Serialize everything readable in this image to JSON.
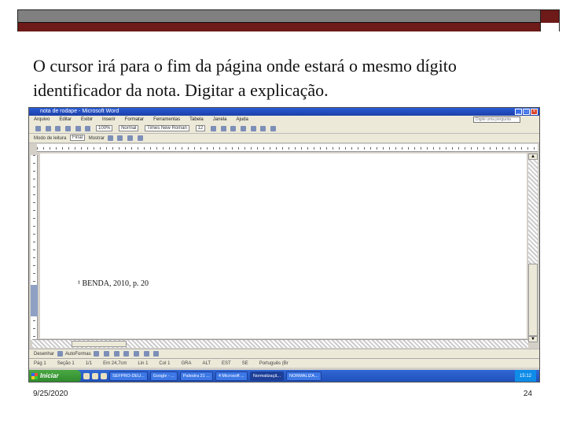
{
  "slide": {
    "text": "O cursor irá para o fim da página onde estará o mesmo dígito identificador da nota. Digitar a explicação.",
    "date": "9/25/2020",
    "page_number": "24"
  },
  "word_window": {
    "title": "nota de rodape - Microsoft Word",
    "menu": [
      "Arquivo",
      "Editar",
      "Exibir",
      "Inserir",
      "Formatar",
      "Ferramentas",
      "Tabela",
      "Janela",
      "Ajuda"
    ],
    "help_placeholder": "Digite uma pergunta",
    "toolbar1": {
      "zoom": "100%",
      "style": "Normal",
      "font": "Times New Roman",
      "font_size": "12"
    },
    "toolbar2": {
      "reading_mode": "Modo de leitura",
      "final_label": "Final",
      "show_label": "Mostrar"
    },
    "doc_text": "¹ BENDA, 2010, p. 20",
    "status_bar": [
      "Pág 1",
      "Seção 1",
      "1/1",
      "Em 24,7cm",
      "Lin 1",
      "Col 1",
      "GRA",
      "ALT",
      "EST",
      "SE",
      "Português (Br"
    ],
    "draw_bar": {
      "draw_label": "Desenhar",
      "autoshapes_label": "AutoFormas"
    }
  },
  "taskbar": {
    "start_label": "Iniciar",
    "items": [
      "SEFPRO-DEU...",
      "Google - ...",
      "Palestra 21 ...",
      "4 Microsoft ...",
      "Normalizaçã...",
      "NORMALIZA..."
    ],
    "clock": "15:12"
  }
}
